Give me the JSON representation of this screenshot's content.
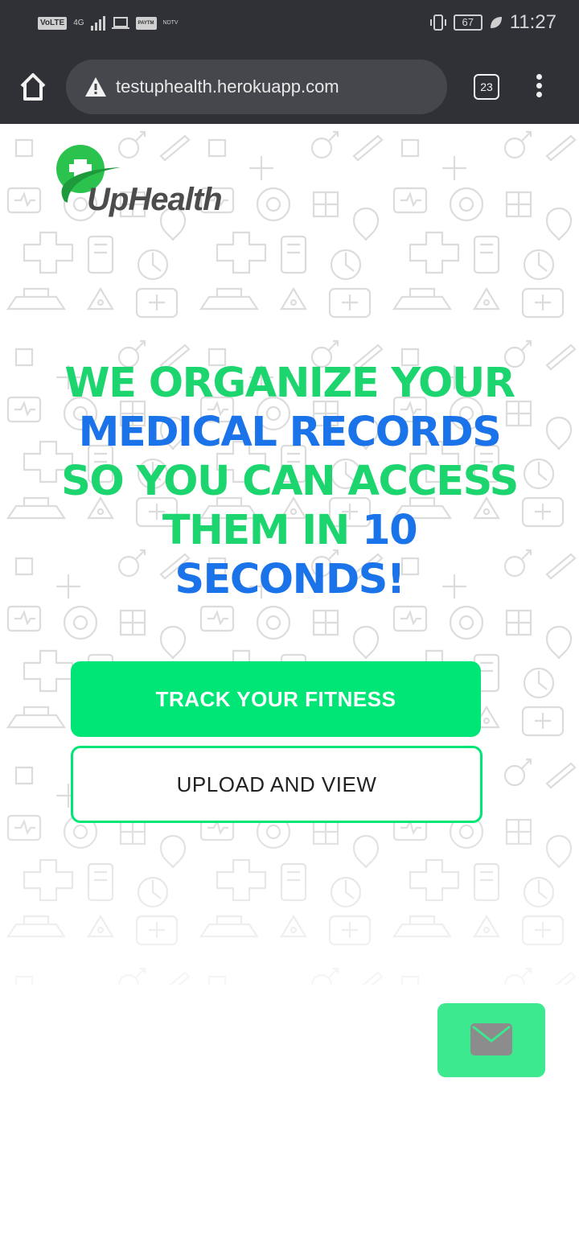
{
  "status_bar": {
    "network_tags": [
      "VoLTE",
      "4G"
    ],
    "app_icons": [
      "laptop-icon",
      "paytm-icon",
      "ndtv-icon"
    ],
    "paytm_label": "PAYTM",
    "ndtv_label": "NDTV",
    "battery": "67",
    "time": "11:27"
  },
  "browser": {
    "url": "testuphealth.herokuapp.com",
    "tab_count": "23"
  },
  "logo": {
    "text": "UpHealth"
  },
  "hero": {
    "line1": "WE ORGANIZE YOUR",
    "line2": "MEDICAL RECORDS",
    "line3": "SO YOU CAN ACCESS",
    "line4_a": "THEM IN ",
    "line4_b": "10",
    "line5": "SECONDS!"
  },
  "buttons": {
    "track": "TRACK YOUR FITNESS",
    "upload": "UPLOAD AND VIEW"
  },
  "colors": {
    "accent_green": "#00e676",
    "accent_blue": "#1a73e8",
    "bar": "#303136"
  }
}
